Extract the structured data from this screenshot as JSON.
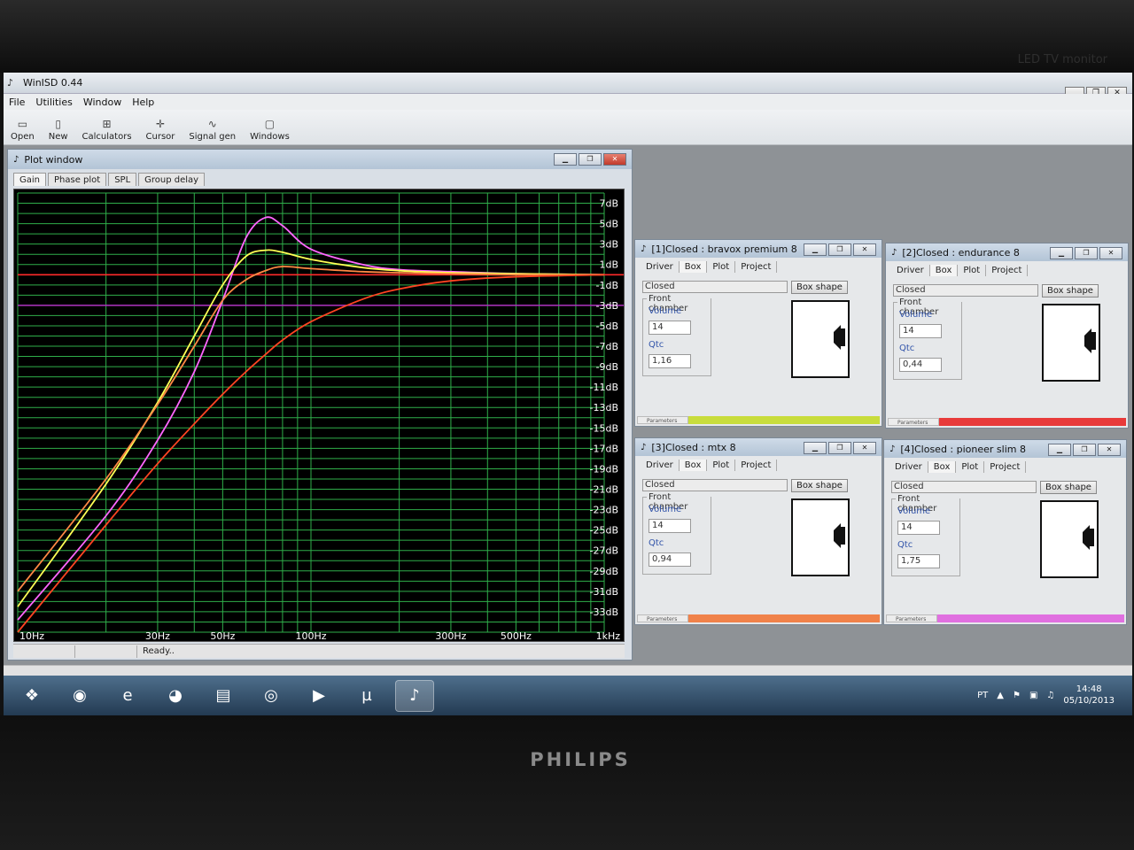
{
  "app": {
    "title": "WinISD 0.44",
    "menu": [
      "File",
      "Utilities",
      "Window",
      "Help"
    ],
    "toolbar": [
      {
        "label": "Open",
        "icon": "folder-open-icon",
        "glyph": "▭"
      },
      {
        "label": "New",
        "icon": "new-file-icon",
        "glyph": "▯"
      },
      {
        "label": "Calculators",
        "icon": "calculator-icon",
        "glyph": "⊞"
      },
      {
        "label": "Cursor",
        "icon": "cursor-crosshair-icon",
        "glyph": "✛"
      },
      {
        "label": "Signal gen",
        "icon": "signal-wave-icon",
        "glyph": "∿"
      },
      {
        "label": "Windows",
        "icon": "windows-icon",
        "glyph": "▢"
      }
    ]
  },
  "plot_window": {
    "title": "Plot window",
    "tabs": [
      "Gain",
      "Phase plot",
      "SPL",
      "Group delay"
    ],
    "active_tab": "Gain",
    "status": "Ready.."
  },
  "chart_data": {
    "type": "line",
    "x_scale": "log",
    "xlim": [
      10,
      1000
    ],
    "ylim": [
      -35,
      8
    ],
    "x_tick_labels": [
      {
        "value": 10,
        "label": "10Hz"
      },
      {
        "value": 30,
        "label": "30Hz"
      },
      {
        "value": 50,
        "label": "50Hz"
      },
      {
        "value": 100,
        "label": "100Hz"
      },
      {
        "value": 300,
        "label": "300Hz"
      },
      {
        "value": 500,
        "label": "500Hz"
      },
      {
        "value": 1000,
        "label": "1kHz"
      }
    ],
    "y_tick_labels": [
      "7dB",
      "5dB",
      "3dB",
      "1dB",
      "-1dB",
      "-3dB",
      "-5dB",
      "-7dB",
      "-9dB",
      "-11dB",
      "-13dB",
      "-15dB",
      "-17dB",
      "-19dB",
      "-21dB",
      "-23dB",
      "-25dB",
      "-27dB",
      "-29dB",
      "-31dB",
      "-33dB"
    ],
    "reference_lines": [
      {
        "y": 0,
        "color": "#ff2a2a"
      },
      {
        "y": -3,
        "color": "#b030c0"
      }
    ],
    "grid": true,
    "series": [
      {
        "color": "#ff66ff",
        "x": [
          10,
          20,
          30,
          40,
          50,
          60,
          70,
          80,
          100,
          150,
          200,
          300,
          500,
          1000
        ],
        "y": [
          -33.8,
          -23.6,
          -16.2,
          -9.5,
          -2.5,
          3.6,
          5.6,
          4.8,
          2.5,
          1.0,
          0.5,
          0.3,
          0.1,
          0
        ]
      },
      {
        "color": "#ffff55",
        "x": [
          10,
          20,
          30,
          40,
          50,
          60,
          70,
          80,
          100,
          150,
          200,
          300,
          500,
          1000
        ],
        "y": [
          -32.5,
          -20.5,
          -12.5,
          -6.0,
          -1.0,
          1.8,
          2.4,
          2.2,
          1.5,
          0.7,
          0.4,
          0.2,
          0.1,
          0
        ]
      },
      {
        "color": "#ff8844",
        "x": [
          10,
          20,
          30,
          40,
          50,
          60,
          70,
          80,
          100,
          150,
          200,
          300,
          500,
          1000
        ],
        "y": [
          -31.0,
          -20.0,
          -12.7,
          -7.0,
          -2.5,
          -0.5,
          0.4,
          0.8,
          0.6,
          0.3,
          0.2,
          0.1,
          0,
          0
        ]
      },
      {
        "color": "#ff4422",
        "x": [
          10,
          20,
          30,
          40,
          50,
          60,
          70,
          80,
          100,
          150,
          200,
          300,
          500,
          1000
        ],
        "y": [
          -35.0,
          -24.5,
          -18.5,
          -14.6,
          -11.7,
          -9.5,
          -7.8,
          -6.4,
          -4.6,
          -2.4,
          -1.4,
          -0.6,
          -0.2,
          0
        ]
      }
    ]
  },
  "speakers": [
    {
      "title": "[1]Closed : bravox premium 8",
      "tabs": [
        "Driver",
        "Box",
        "Plot",
        "Project"
      ],
      "box_type": "Closed",
      "shape_button": "Box shape",
      "chamber_label": "Front chamber",
      "volume_label": "Volume",
      "volume": "14",
      "qtc_label": "Qtc",
      "qtc": "1,16",
      "params_label": "Parameters",
      "color": "#c8dc3c"
    },
    {
      "title": "[2]Closed : endurance 8",
      "tabs": [
        "Driver",
        "Box",
        "Plot",
        "Project"
      ],
      "box_type": "Closed",
      "shape_button": "Box shape",
      "chamber_label": "Front chamber",
      "volume_label": "Volume",
      "volume": "14",
      "qtc_label": "Qtc",
      "qtc": "0,44",
      "params_label": "Parameters",
      "color": "#e83a3a"
    },
    {
      "title": "[3]Closed : mtx 8",
      "tabs": [
        "Driver",
        "Box",
        "Plot",
        "Project"
      ],
      "box_type": "Closed",
      "shape_button": "Box shape",
      "chamber_label": "Front chamber",
      "volume_label": "Volume",
      "volume": "14",
      "qtc_label": "Qtc",
      "qtc": "0,94",
      "params_label": "Parameters",
      "color": "#f0824a"
    },
    {
      "title": "[4]Closed : pioneer slim 8",
      "tabs": [
        "Driver",
        "Box",
        "Plot",
        "Project"
      ],
      "box_type": "Closed",
      "shape_button": "Box shape",
      "chamber_label": "Front chamber",
      "volume_label": "Volume",
      "volume": "14",
      "qtc_label": "Qtc",
      "qtc": "1,75",
      "params_label": "Parameters",
      "color": "#e070e0"
    }
  ],
  "taskbar": {
    "apps": [
      {
        "icon": "windows-start-icon",
        "glyph": "❖"
      },
      {
        "icon": "chrome-icon",
        "glyph": "◉"
      },
      {
        "icon": "internet-explorer-icon",
        "glyph": "e"
      },
      {
        "icon": "firefox-icon",
        "glyph": "◕"
      },
      {
        "icon": "file-explorer-icon",
        "glyph": "▤"
      },
      {
        "icon": "media-center-icon",
        "glyph": "◎"
      },
      {
        "icon": "media-player-icon",
        "glyph": "▶"
      },
      {
        "icon": "utorrent-icon",
        "glyph": "µ"
      },
      {
        "icon": "winisd-icon",
        "glyph": "♪"
      }
    ],
    "language": "PT",
    "time": "14:48",
    "date": "05/10/2013"
  },
  "monitor": {
    "brand": "PHILIPS",
    "label": "LED TV monitor"
  }
}
